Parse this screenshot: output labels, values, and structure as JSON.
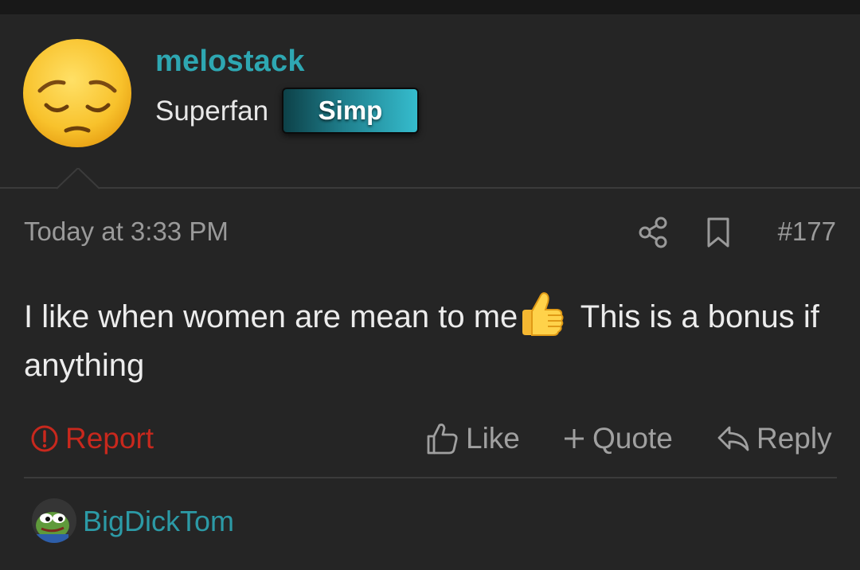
{
  "author": {
    "username": "melostack",
    "title": "Superfan",
    "banner": "Simp",
    "avatar_icon": "pensive-face-emoji",
    "username_color": "#2ea7b2"
  },
  "post": {
    "date": "Today at 3:33 PM",
    "number": "#177",
    "text_before": "I like when women are mean to me",
    "inline_icon": "thumbs-up-emoji",
    "text_after": " This is a bonus if anything"
  },
  "actions": {
    "report": "Report",
    "like": "Like",
    "quote": "Quote",
    "reply": "Reply",
    "report_color": "#c8281d"
  },
  "next_post": {
    "username": "BigDickTom",
    "avatar_icon": "pepe-frog-icon"
  },
  "icons": {
    "share": "share-icon",
    "bookmark": "bookmark-icon"
  }
}
